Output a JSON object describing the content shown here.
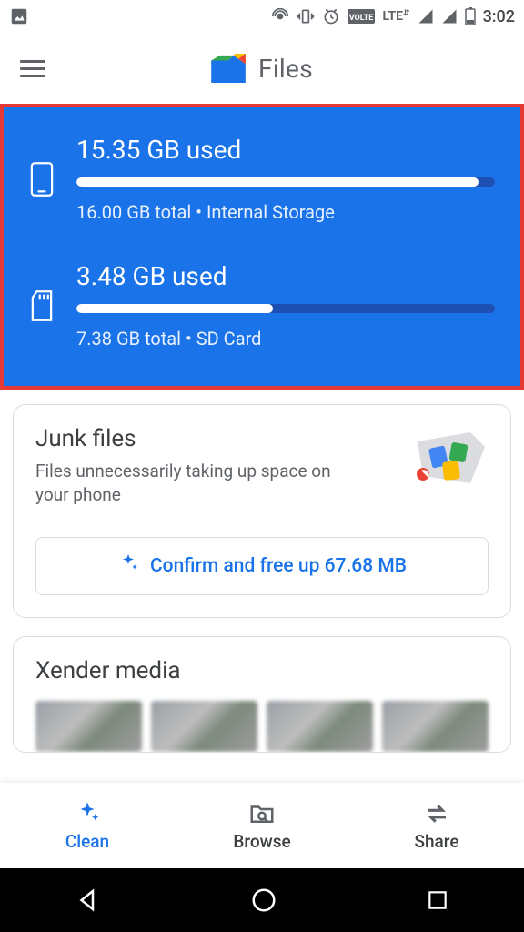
{
  "status": {
    "time": "3:02"
  },
  "header": {
    "title": "Files"
  },
  "storage": [
    {
      "icon": "phone",
      "used_label": "15.35 GB used",
      "total_label": "16.00 GB total • Internal Storage",
      "fill_pct": 96
    },
    {
      "icon": "sdcard",
      "used_label": "3.48 GB used",
      "total_label": "7.38 GB total • SD Card",
      "fill_pct": 47
    }
  ],
  "junk": {
    "title": "Junk files",
    "desc": "Files unnecessarily taking up space on your phone",
    "button_label": "Confirm and free up 67.68 MB"
  },
  "xender": {
    "title": "Xender media"
  },
  "nav": {
    "clean": "Clean",
    "browse": "Browse",
    "share": "Share"
  }
}
